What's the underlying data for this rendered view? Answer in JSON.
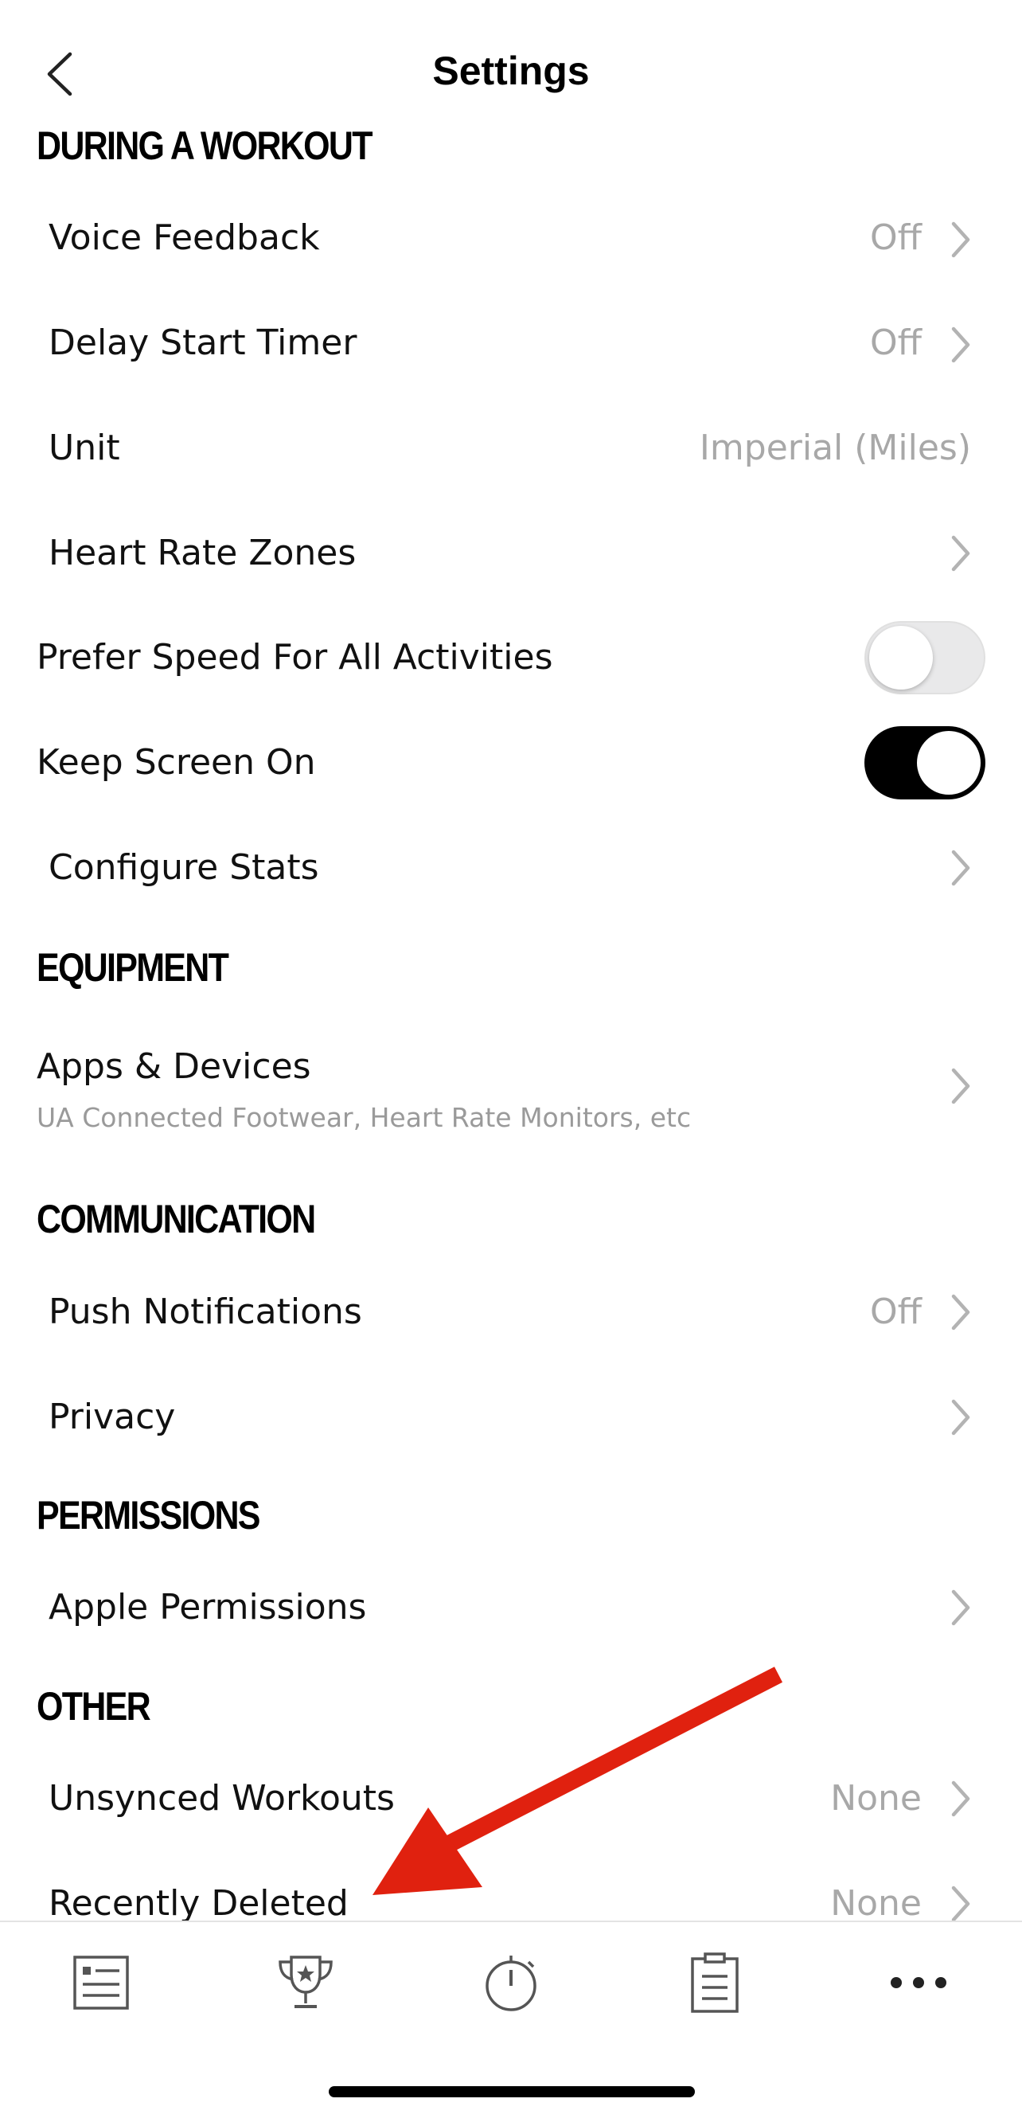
{
  "header": {
    "title": "Settings",
    "back_icon": "chevron-left-icon"
  },
  "sections": {
    "workout": "DURING A WORKOUT",
    "equipment": "EQUIPMENT",
    "communication": "COMMUNICATION",
    "permissions": "PERMISSIONS",
    "other": "OTHER"
  },
  "rows": {
    "voice_feedback": {
      "label": "Voice Feedback",
      "value": "Off"
    },
    "delay_start_timer": {
      "label": "Delay Start Timer",
      "value": "Off"
    },
    "unit": {
      "label": "Unit",
      "value": "Imperial (Miles)"
    },
    "heart_rate_zones": {
      "label": "Heart Rate Zones"
    },
    "prefer_speed": {
      "label": "Prefer Speed For All Activities",
      "enabled": false
    },
    "keep_screen_on": {
      "label": "Keep Screen On",
      "enabled": true
    },
    "configure_stats": {
      "label": "Configure Stats"
    },
    "apps_devices": {
      "label": "Apps & Devices",
      "subtitle": "UA Connected Footwear, Heart Rate Monitors, etc"
    },
    "push_notifications": {
      "label": "Push Notifications",
      "value": "Off"
    },
    "privacy": {
      "label": "Privacy"
    },
    "apple_permissions": {
      "label": "Apple Permissions"
    },
    "unsynced_workouts": {
      "label": "Unsynced Workouts",
      "value": "None"
    },
    "recently_deleted": {
      "label": "Recently Deleted",
      "value": "None"
    }
  },
  "tabbar": {
    "items": [
      "feed-icon",
      "trophy-icon",
      "stopwatch-icon",
      "clipboard-icon",
      "more-icon"
    ]
  },
  "annotation": {
    "arrow_color": "#e0210f"
  },
  "colors": {
    "secondary_text": "#a8a8a8",
    "toggle_on": "#000000"
  }
}
